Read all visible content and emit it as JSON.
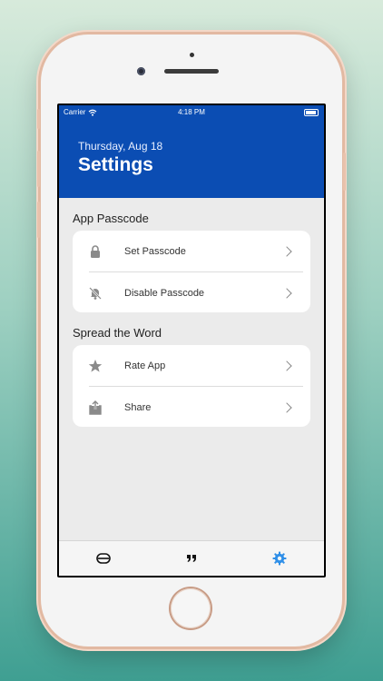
{
  "status_bar": {
    "carrier": "Carrier",
    "time": "4:18 PM"
  },
  "header": {
    "date": "Thursday, Aug 18",
    "title": "Settings",
    "color": "#0b4db3"
  },
  "sections": [
    {
      "title": "App Passcode",
      "items": [
        {
          "label": "Set Passcode",
          "icon": "lock-icon"
        },
        {
          "label": "Disable Passcode",
          "icon": "bell-slash-icon"
        }
      ]
    },
    {
      "title": "Spread the Word",
      "items": [
        {
          "label": "Rate App",
          "icon": "star-icon"
        },
        {
          "label": "Share",
          "icon": "share-icon"
        }
      ]
    }
  ],
  "tab_bar": {
    "tabs": [
      {
        "icon": "capsule-icon",
        "active": false
      },
      {
        "icon": "quote-icon",
        "active": false
      },
      {
        "icon": "gear-icon",
        "active": true
      }
    ],
    "active_color": "#2f8fe8"
  }
}
